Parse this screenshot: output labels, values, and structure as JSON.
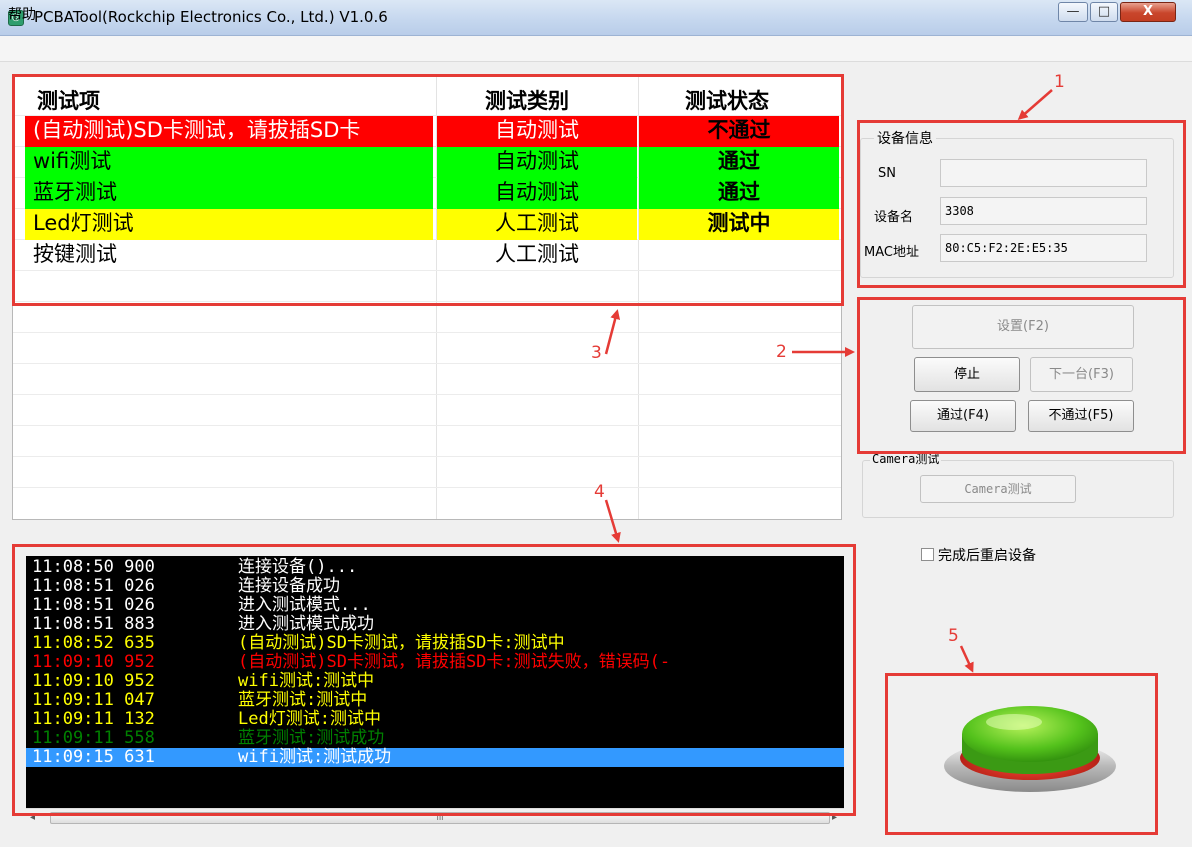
{
  "window": {
    "title": "PCBATool(Rockchip Electronics Co., Ltd.) V1.0.6",
    "minimize": "—",
    "maximize": "□",
    "close": "X",
    "menu_help": "帮助"
  },
  "tests": {
    "headers": [
      "测试项",
      "测试类别",
      "测试状态"
    ],
    "rows": [
      {
        "item": "(自动测试)SD卡测试，请拔插SD卡",
        "category": "自动测试",
        "status": "不通过"
      },
      {
        "item": "wifi测试",
        "category": "自动测试",
        "status": "通过"
      },
      {
        "item": "蓝牙测试",
        "category": "自动测试",
        "status": "通过"
      },
      {
        "item": "Led灯测试",
        "category": "人工测试",
        "status": "测试中"
      },
      {
        "item": "按键测试",
        "category": "人工测试",
        "status": ""
      }
    ]
  },
  "device_info": {
    "group_title": "设备信息",
    "sn_label": "SN",
    "sn_value": "",
    "name_label": "设备名",
    "name_value": "3308",
    "mac_label": "MAC地址",
    "mac_value": "80:C5:F2:2E:E5:35"
  },
  "controls": {
    "settings": "设置(F2)",
    "stop": "停止",
    "next": "下一台(F3)",
    "pass": "通过(F4)",
    "fail": "不通过(F5)",
    "camera_group_title": "Camera测试",
    "camera_button": "Camera测试",
    "reboot_checkbox_label": "完成后重启设备",
    "reboot_checked": false
  },
  "log": [
    {
      "time": "11:08:50 900",
      "msg": "连接设备()...",
      "color": "#ffffff"
    },
    {
      "time": "11:08:51 026",
      "msg": "连接设备成功",
      "color": "#ffffff"
    },
    {
      "time": "11:08:51 026",
      "msg": "进入测试模式...",
      "color": "#ffffff"
    },
    {
      "time": "11:08:51 883",
      "msg": "进入测试模式成功",
      "color": "#ffffff"
    },
    {
      "time": "11:08:52 635",
      "msg": "(自动测试)SD卡测试，请拔插SD卡:测试中",
      "color": "#ffff00"
    },
    {
      "time": "11:09:10 952",
      "msg": "(自动测试)SD卡测试，请拔插SD卡:测试失败，错误码(-",
      "color": "#ff0000"
    },
    {
      "time": "11:09:10 952",
      "msg": "wifi测试:测试中",
      "color": "#ffff00"
    },
    {
      "time": "11:09:11 047",
      "msg": "蓝牙测试:测试中",
      "color": "#ffff00"
    },
    {
      "time": "11:09:11 132",
      "msg": "Led灯测试:测试中",
      "color": "#ffff00"
    },
    {
      "time": "11:09:11 558",
      "msg": "蓝牙测试:测试成功",
      "color": "#008000"
    },
    {
      "time": "11:09:15 631",
      "msg": "wifi测试:测试成功",
      "color": "#ffffff",
      "selected": true
    }
  ],
  "scrollbar_grip": "III",
  "annotations": [
    "1",
    "2",
    "3",
    "4",
    "5"
  ],
  "colors": {
    "fail": "#ff0000",
    "pass": "#00ff00",
    "testing": "#ffff00",
    "annotation": "#e53b36",
    "log_selected": "#3399ff"
  }
}
